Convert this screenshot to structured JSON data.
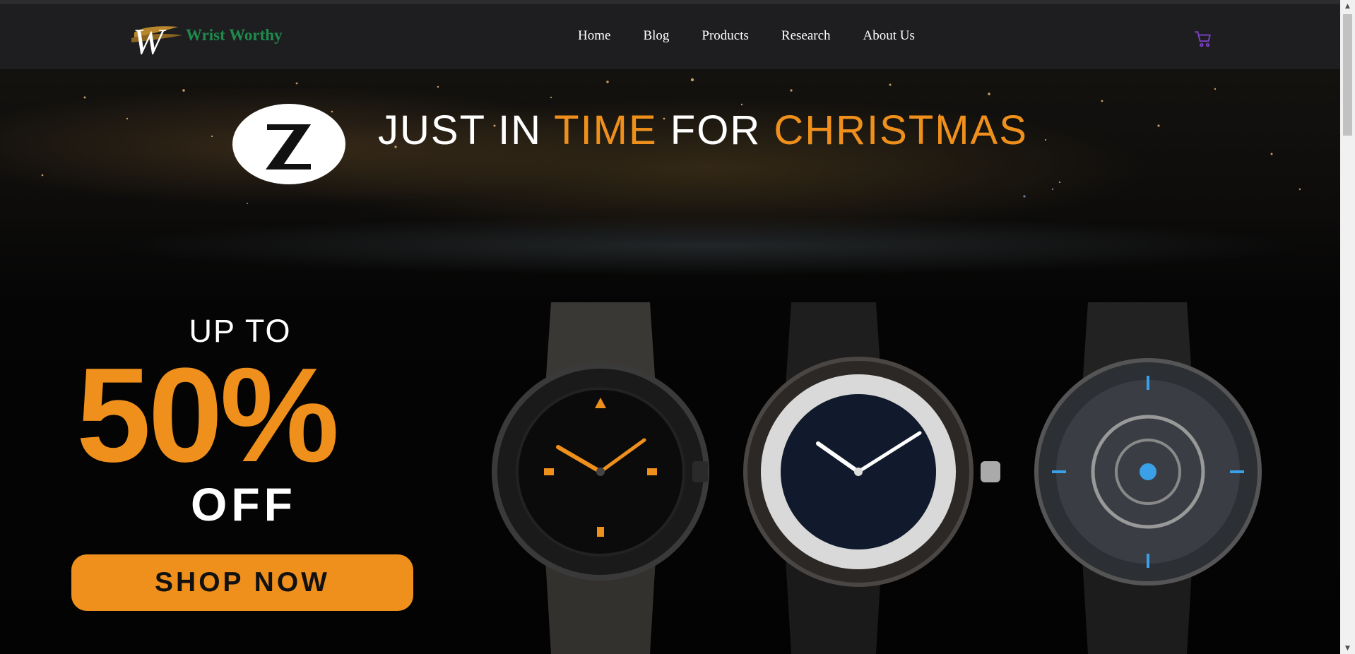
{
  "brand": {
    "name": "Wrist Worthy",
    "color": "#1f8a4c",
    "logo_icon": "ww-monogram-icon"
  },
  "nav": {
    "items": [
      {
        "label": "Home"
      },
      {
        "label": "Blog"
      },
      {
        "label": "Products"
      },
      {
        "label": "Research"
      },
      {
        "label": "About Us"
      }
    ],
    "cart_icon": "shopping-cart-icon"
  },
  "hero": {
    "headline": {
      "part1": "JUST IN ",
      "part2": "TIME",
      "part3": " FOR ",
      "part4": "CHRISTMAS"
    },
    "promo": {
      "up_to": "UP TO",
      "percent": "50%",
      "off": "OFF"
    },
    "cta": "SHOP NOW",
    "accent_color": "#f0901c"
  }
}
